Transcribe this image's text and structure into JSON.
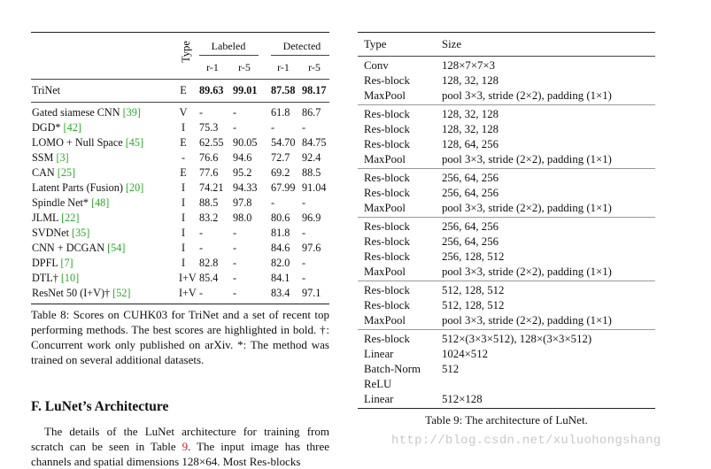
{
  "table8": {
    "header": {
      "type": "Type",
      "labeled": "Labeled",
      "detected": "Detected",
      "sub": [
        "r-1",
        "r-5",
        "r-1",
        "r-5"
      ]
    },
    "trinet": {
      "name": "TriNet",
      "type": "E",
      "l1": "89.63",
      "l5": "99.01",
      "d1": "87.58",
      "d5": "98.17"
    },
    "rows": [
      {
        "name": "Gated siamese CNN ",
        "cite": "[39]",
        "type": "V",
        "l1": "-",
        "l5": "-",
        "d1": "61.8",
        "d5": "86.7"
      },
      {
        "name": "DGD* ",
        "cite": "[42]",
        "type": "I",
        "l1": "75.3",
        "l5": "-",
        "d1": "-",
        "d5": "-"
      },
      {
        "name": "LOMO + Null Space ",
        "cite": "[45]",
        "type": "E",
        "l1": "62.55",
        "l5": "90.05",
        "d1": "54.70",
        "d5": "84.75"
      },
      {
        "name": "SSM ",
        "cite": "[3]",
        "type": "-",
        "l1": "76.6",
        "l5": "94.6",
        "d1": "72.7",
        "d5": "92.4"
      },
      {
        "name": "CAN ",
        "cite": "[25]",
        "type": "E",
        "l1": "77.6",
        "l5": "95.2",
        "d1": "69.2",
        "d5": "88.5"
      },
      {
        "name": "Latent Parts (Fusion) ",
        "cite": "[20]",
        "type": "I",
        "l1": "74.21",
        "l5": "94.33",
        "d1": "67.99",
        "d5": "91.04"
      },
      {
        "name": "Spindle Net* ",
        "cite": "[48]",
        "type": "I",
        "l1": "88.5",
        "l5": "97.8",
        "d1": "-",
        "d5": "-"
      },
      {
        "name": "JLML ",
        "cite": "[22]",
        "type": "I",
        "l1": "83.2",
        "l5": "98.0",
        "d1": "80.6",
        "d5": "96.9"
      },
      {
        "name": "SVDNet ",
        "cite": "[35]",
        "type": "I",
        "l1": "-",
        "l5": "-",
        "d1": "81.8",
        "d5": "-"
      },
      {
        "name": "CNN + DCGAN ",
        "cite": "[54]",
        "type": "I",
        "l1": "-",
        "l5": "-",
        "d1": "84.6",
        "d5": "97.6"
      },
      {
        "name": "DPFL ",
        "cite": "[7]",
        "type": "I",
        "l1": "82.8",
        "l5": "-",
        "d1": "82.0",
        "d5": "-"
      },
      {
        "name": "DTL† ",
        "cite": "[10]",
        "type": "I+V",
        "l1": "85.4",
        "l5": "-",
        "d1": "84.1",
        "d5": "-"
      },
      {
        "name": "ResNet 50 (I+V)† ",
        "cite": "[52]",
        "type": "I+V",
        "l1": "-",
        "l5": "-",
        "d1": "83.4",
        "d5": "97.1"
      }
    ],
    "caption": "Table 8: Scores on CUHK03 for TriNet and a set of recent top performing methods. The best scores are highlighted in bold. †: Concurrent work only published on arXiv. *: The method was trained on several additional datasets."
  },
  "section": {
    "title": "F. LuNet’s Architecture",
    "para_a": "The details of the LuNet architecture for training from scratch can be seen in Table ",
    "para_ref": "9",
    "para_b": ". The input image has three channels and spatial dimensions 128×64. Most Res-blocks"
  },
  "table9": {
    "header": {
      "type": "Type",
      "size": "Size"
    },
    "groups": [
      [
        {
          "t": "Conv",
          "s": "128×7×7×3"
        },
        {
          "t": "Res-block",
          "s": "128, 32, 128"
        },
        {
          "t": "MaxPool",
          "s": "pool 3×3, stride (2×2), padding (1×1)"
        }
      ],
      [
        {
          "t": "Res-block",
          "s": "128, 32, 128"
        },
        {
          "t": "Res-block",
          "s": "128, 32, 128"
        },
        {
          "t": "Res-block",
          "s": "128, 64, 256"
        },
        {
          "t": "MaxPool",
          "s": "pool 3×3, stride (2×2), padding (1×1)"
        }
      ],
      [
        {
          "t": "Res-block",
          "s": "256, 64, 256"
        },
        {
          "t": "Res-block",
          "s": "256, 64, 256"
        },
        {
          "t": "MaxPool",
          "s": "pool 3×3, stride (2×2), padding (1×1)"
        }
      ],
      [
        {
          "t": "Res-block",
          "s": "256, 64, 256"
        },
        {
          "t": "Res-block",
          "s": "256, 64, 256"
        },
        {
          "t": "Res-block",
          "s": "256, 128, 512"
        },
        {
          "t": "MaxPool",
          "s": "pool 3×3, stride (2×2), padding (1×1)"
        }
      ],
      [
        {
          "t": "Res-block",
          "s": "512, 128, 512"
        },
        {
          "t": "Res-block",
          "s": "512, 128, 512"
        },
        {
          "t": "MaxPool",
          "s": "pool 3×3, stride (2×2), padding (1×1)"
        }
      ],
      [
        {
          "t": "Res-block",
          "s": "512×(3×3×512), 128×(3×3×512)"
        },
        {
          "t": "Linear",
          "s": "1024×512"
        },
        {
          "t": "Batch-Norm",
          "s": "512"
        },
        {
          "t": "ReLU",
          "s": ""
        },
        {
          "t": "Linear",
          "s": "512×128"
        }
      ]
    ],
    "caption": "Table 9: The architecture of LuNet."
  },
  "watermark": "http://blog.csdn.net/xuluohongshang"
}
